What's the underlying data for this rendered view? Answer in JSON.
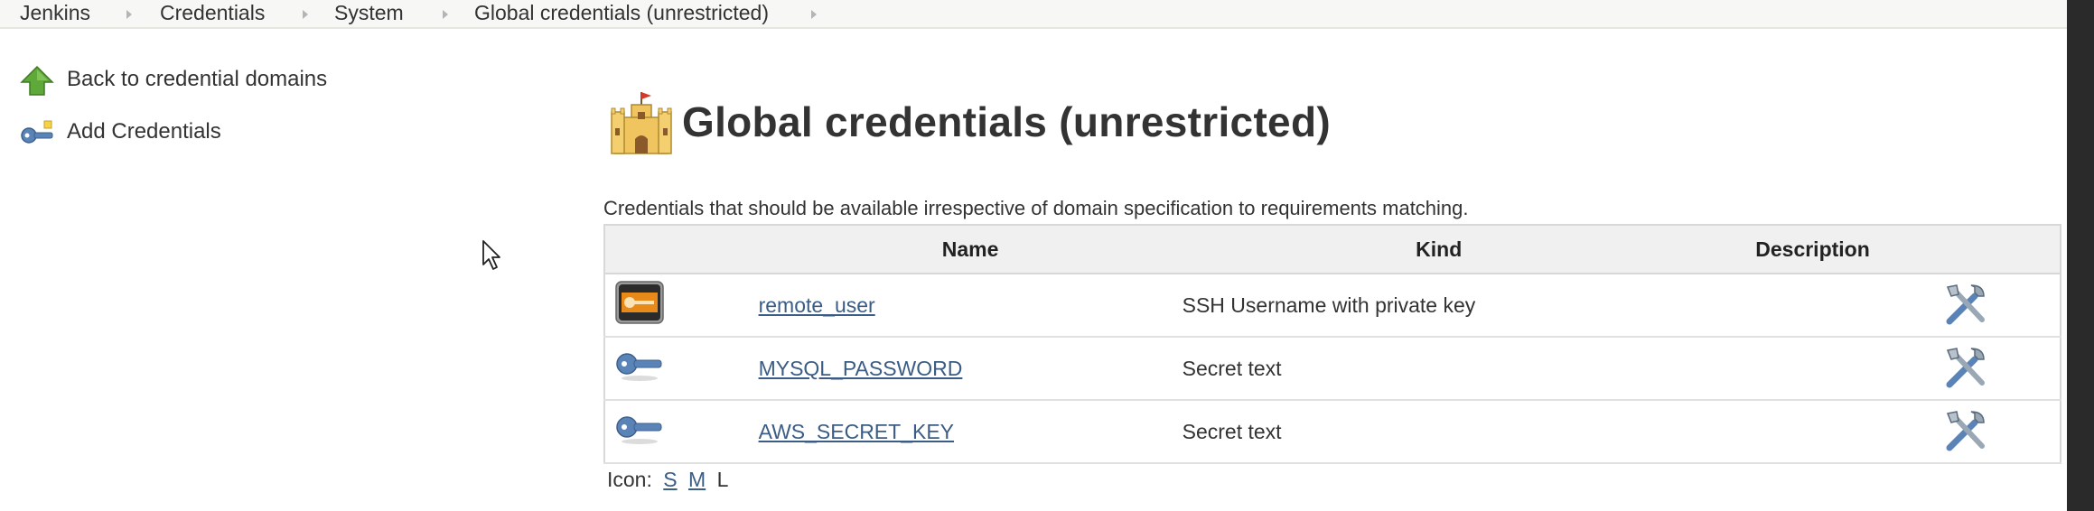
{
  "breadcrumb": {
    "items": [
      "Jenkins",
      "Credentials",
      "System",
      "Global credentials (unrestricted)"
    ]
  },
  "side_panel": {
    "back_label": "Back to credential domains",
    "back_icon": "green-up-arrow-icon",
    "add_label": "Add Credentials",
    "add_icon": "key-add-icon"
  },
  "main": {
    "title": "Global credentials (unrestricted)",
    "title_icon": "castle-icon",
    "description": "Credentials that should be available irrespective of domain specification to requirements matching.",
    "table": {
      "headers": {
        "name": "Name",
        "kind": "Kind",
        "description": "Description"
      },
      "rows": [
        {
          "icon": "ssh-key-card-icon",
          "name": "remote_user",
          "kind": "SSH Username with private key",
          "description": ""
        },
        {
          "icon": "key-icon",
          "name": "MYSQL_PASSWORD",
          "kind": "Secret text",
          "description": ""
        },
        {
          "icon": "key-icon",
          "name": "AWS_SECRET_KEY",
          "kind": "Secret text",
          "description": ""
        }
      ]
    },
    "icon_size": {
      "label": "Icon:",
      "options": [
        "S",
        "M",
        "L"
      ],
      "current": "L"
    }
  },
  "colors": {
    "link": "#3b5c84",
    "breadcrumb_bg": "#f7f7f5",
    "table_header_bg": "#f0f0f0",
    "key_blue": "#5a84b8"
  }
}
